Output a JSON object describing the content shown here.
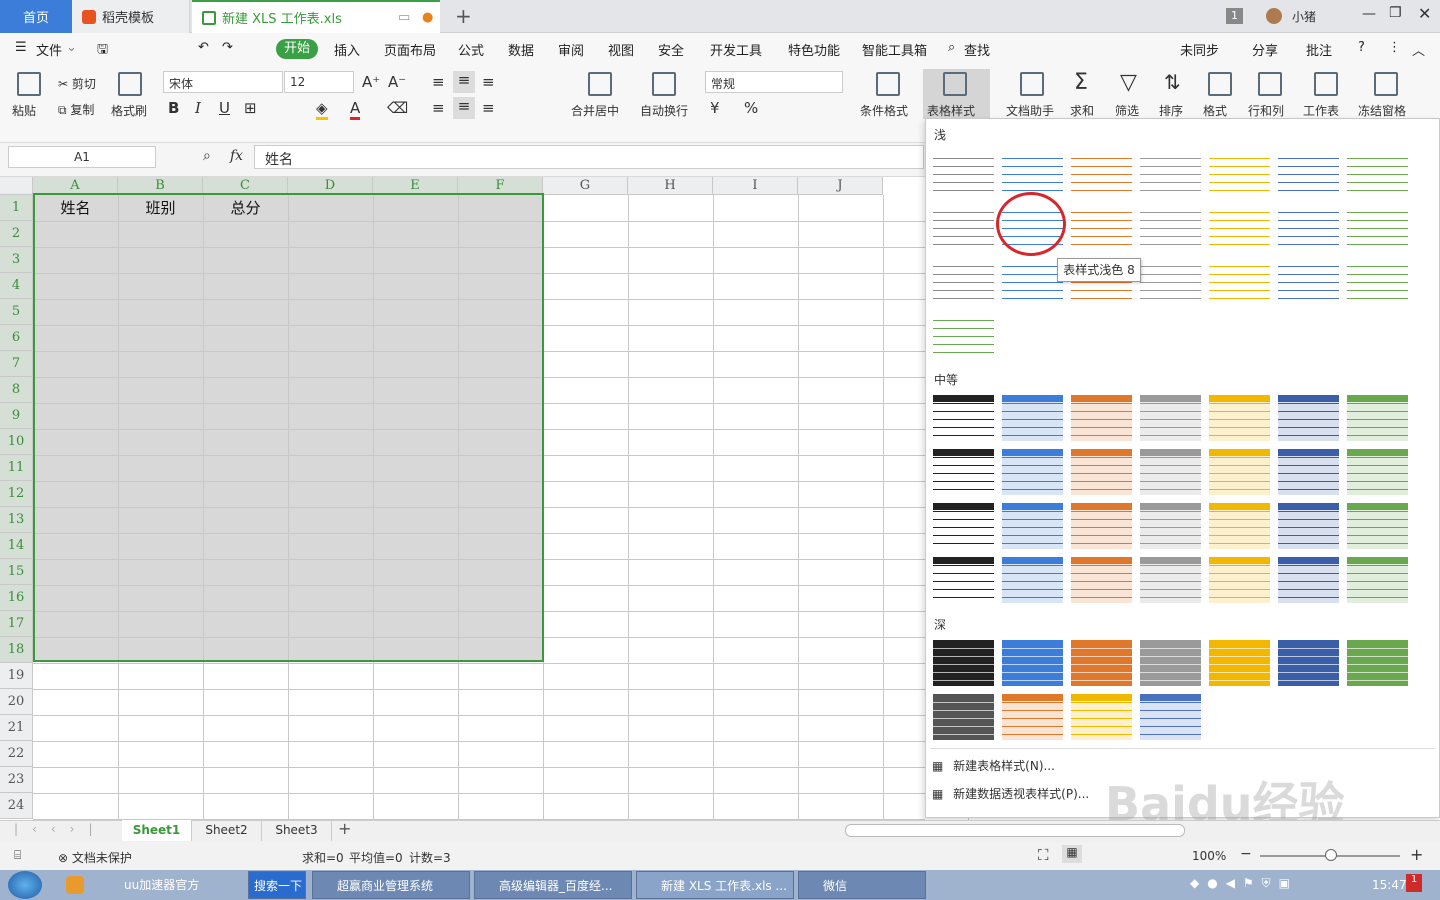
{
  "tabs": {
    "home": "首页",
    "daoke": "稻壳模板",
    "file": "新建 XLS 工作表.xls",
    "count": "1",
    "user": "小猪"
  },
  "menu": {
    "file": "文件",
    "start": "开始",
    "insert": "插入",
    "layout": "页面布局",
    "formula": "公式",
    "data": "数据",
    "review": "审阅",
    "view": "视图",
    "security": "安全",
    "dev": "开发工具",
    "special": "特色功能",
    "smart": "智能工具箱",
    "find": "查找",
    "unsync": "未同步",
    "share": "分享",
    "comment": "批注"
  },
  "ribbon": {
    "paste": "粘贴",
    "cut": "剪切",
    "copy": "复制",
    "format_painter": "格式刷",
    "font": "宋体",
    "size": "12",
    "bold": "B",
    "italic": "I",
    "underline": "U",
    "merge": "合并居中",
    "wrap": "自动换行",
    "number_format": "常规",
    "percent": "%",
    "cond_format": "条件格式",
    "table_style": "表格样式",
    "doc_helper": "文档助手",
    "sum": "求和",
    "filter": "筛选",
    "sort": "排序",
    "format": "格式",
    "rowcol": "行和列",
    "sheet": "工作表",
    "freeze": "冻结窗格"
  },
  "formula": {
    "cell_ref": "A1",
    "fx": "fx",
    "content": "姓名"
  },
  "columns": [
    "A",
    "B",
    "C",
    "D",
    "E",
    "F",
    "G",
    "H",
    "I",
    "J"
  ],
  "rows": [
    "1",
    "2",
    "3",
    "4",
    "5",
    "6",
    "7",
    "8",
    "9",
    "10",
    "11",
    "12",
    "13",
    "14",
    "15",
    "16",
    "17",
    "18",
    "19",
    "20",
    "21",
    "22",
    "23",
    "24"
  ],
  "cells": {
    "a1": "姓名",
    "b1": "班别",
    "c1": "总分"
  },
  "dropdown": {
    "light": "浅",
    "medium": "中等",
    "dark": "深",
    "tooltip": "表样式浅色 8",
    "new_table_style": "新建表格样式(N)...",
    "new_pivot_style": "新建数据透视表样式(P)..."
  },
  "sheets": [
    "Sheet1",
    "Sheet2",
    "Sheet3"
  ],
  "status": {
    "protect": "文档未保护",
    "sum": "求和=0",
    "avg": "平均值=0",
    "count": "计数=3",
    "zoom": "100%"
  },
  "taskbar": {
    "uu": "uu加速器官方",
    "search": "搜索一下",
    "app1": "超赢商业管理系统",
    "app2": "高级编辑器_百度经...",
    "app3": "新建 XLS 工作表.xls ...",
    "app4": "微信",
    "time": "15:47"
  },
  "watermark": "Baidu经验",
  "colors": {
    "accent_green": "#3a9a3a",
    "blue": "#3b7dd8",
    "orange": "#e0782c",
    "gold": "#f2b800",
    "gray": "#9a9a9a",
    "green": "#6aa84f"
  }
}
